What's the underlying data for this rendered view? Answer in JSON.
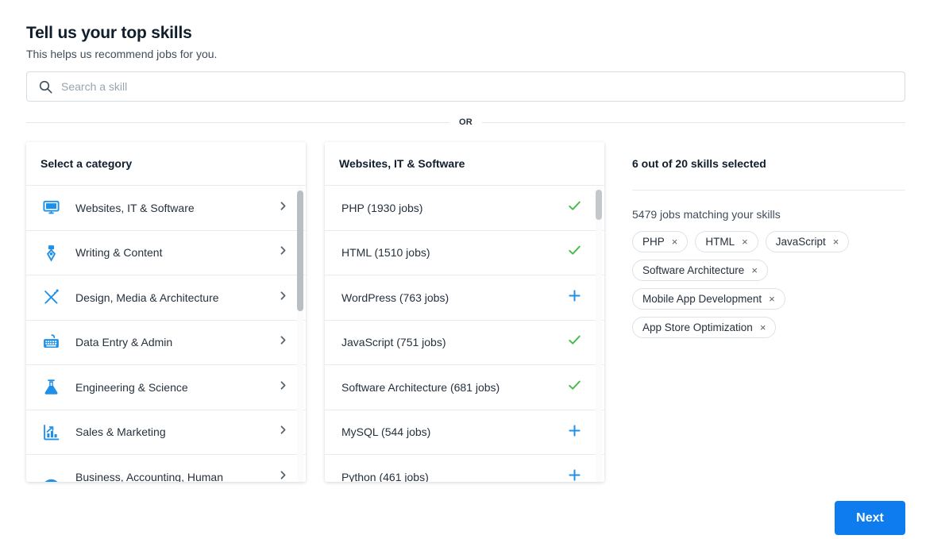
{
  "header": {
    "title": "Tell us your top skills",
    "subtitle": "This helps us recommend jobs for you."
  },
  "search": {
    "placeholder": "Search a skill",
    "value": "",
    "icon": "search-icon"
  },
  "divider": {
    "text": "OR"
  },
  "category_panel": {
    "heading": "Select a category",
    "items": [
      {
        "label": "Websites, IT & Software",
        "icon": "monitor-icon",
        "selected": true
      },
      {
        "label": "Writing & Content",
        "icon": "pen-nib-icon",
        "selected": false
      },
      {
        "label": "Design, Media & Architecture",
        "icon": "crossed-tools-icon",
        "selected": false
      },
      {
        "label": "Data Entry & Admin",
        "icon": "keyboard-icon",
        "selected": false
      },
      {
        "label": "Engineering & Science",
        "icon": "flask-icon",
        "selected": false
      },
      {
        "label": "Sales & Marketing",
        "icon": "bar-chart-arrow-icon",
        "selected": false
      },
      {
        "label": "Business, Accounting, Human",
        "icon": "briefcase-icon",
        "selected": false
      }
    ]
  },
  "skill_panel": {
    "heading": "Websites, IT & Software",
    "items": [
      {
        "label": "PHP (1930 jobs)",
        "state": "selected",
        "marker": "check-icon"
      },
      {
        "label": "HTML (1510 jobs)",
        "state": "selected",
        "marker": "check-icon"
      },
      {
        "label": "WordPress (763 jobs)",
        "state": "unselected",
        "marker": "plus-icon"
      },
      {
        "label": "JavaScript (751 jobs)",
        "state": "selected",
        "marker": "check-icon"
      },
      {
        "label": "Software Architecture (681 jobs)",
        "state": "selected",
        "marker": "check-icon"
      },
      {
        "label": "MySQL (544 jobs)",
        "state": "unselected",
        "marker": "plus-icon"
      },
      {
        "label": "Python (461 jobs)",
        "state": "unselected",
        "marker": "plus-icon"
      }
    ]
  },
  "selected_panel": {
    "heading": "6 out of 20 skills selected",
    "match_count": "5479 jobs matching your skills",
    "chips": [
      {
        "label": "PHP",
        "remove": "×"
      },
      {
        "label": "HTML",
        "remove": "×"
      },
      {
        "label": "JavaScript",
        "remove": "×"
      },
      {
        "label": "Software Architecture",
        "remove": "×"
      },
      {
        "label": "Mobile App Development",
        "remove": "×"
      },
      {
        "label": "App Store Optimization",
        "remove": "×"
      }
    ]
  },
  "footer": {
    "next_label": "Next"
  },
  "colors": {
    "accent_blue": "#1e90e8",
    "button_blue": "#0e7cef",
    "check_green": "#44bb4a",
    "text_dark": "#101d2b",
    "text_body": "#26313c",
    "border": "#e8ebee"
  }
}
